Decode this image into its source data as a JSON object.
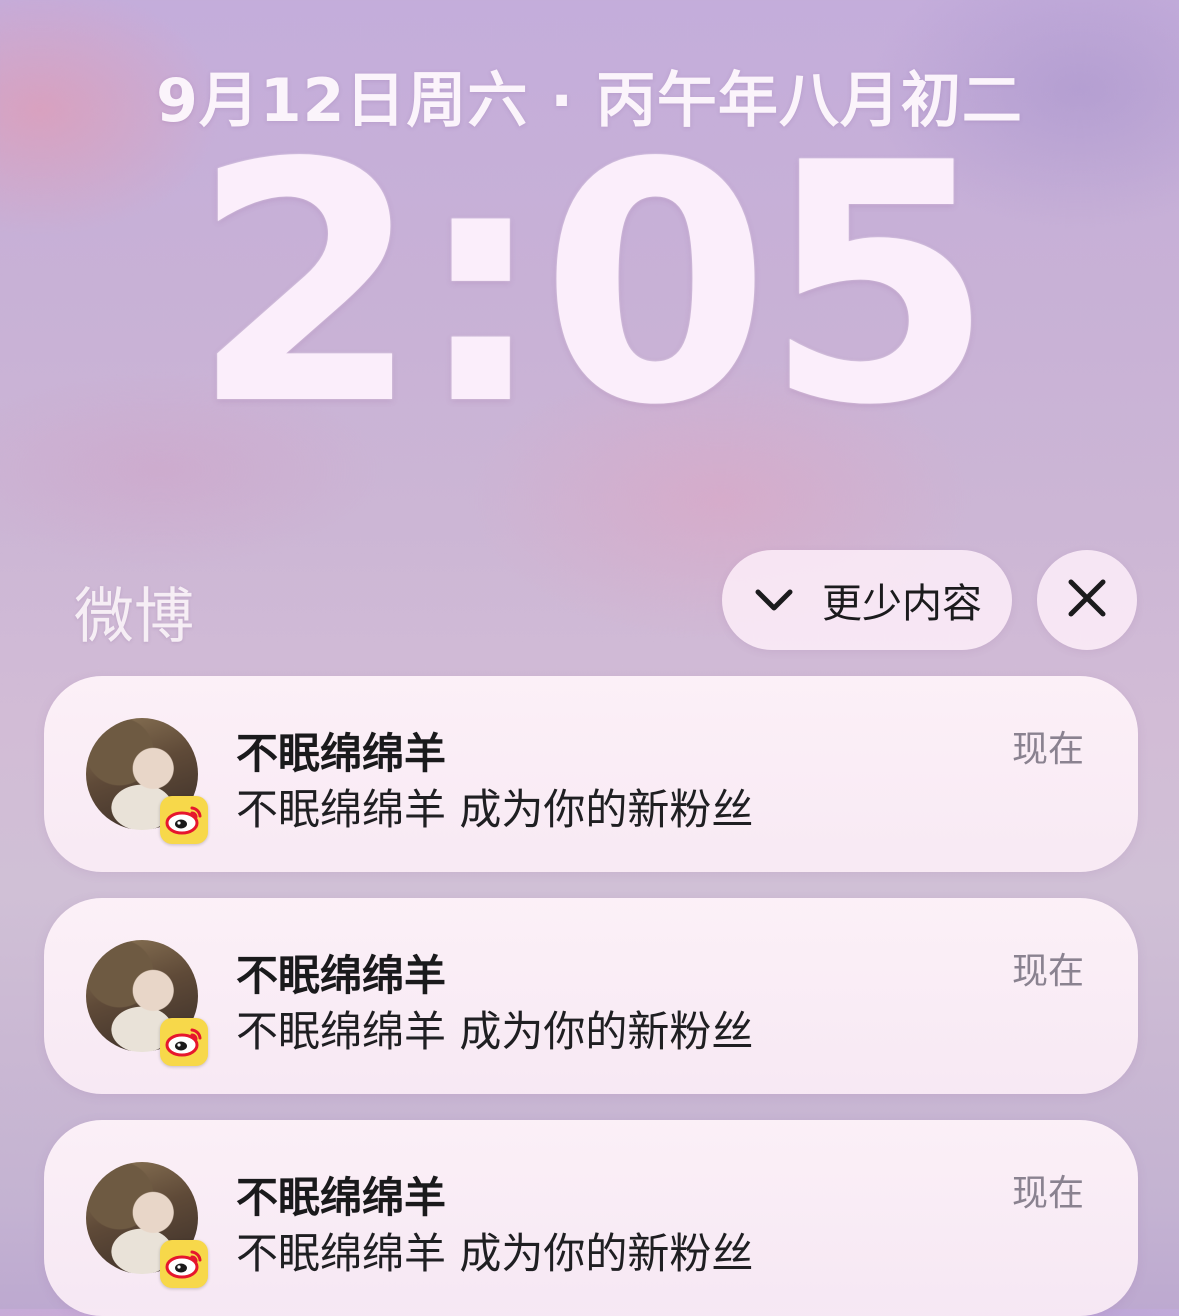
{
  "lockscreen": {
    "date": "9月12日周六 · 丙午年八月初二",
    "time": "2:05"
  },
  "notification_group": {
    "app_name": "微博",
    "show_less_label": "更少内容",
    "close_icon": "close-icon",
    "chevron_icon": "chevron-down-icon",
    "notifications": [
      {
        "sender": "不眠绵绵羊",
        "message": "不眠绵绵羊 成为你的新粉丝",
        "time": "现在",
        "app_badge_icon": "weibo-icon"
      },
      {
        "sender": "不眠绵绵羊",
        "message": "不眠绵绵羊 成为你的新粉丝",
        "time": "现在",
        "app_badge_icon": "weibo-icon"
      },
      {
        "sender": "不眠绵绵羊",
        "message": "不眠绵绵羊 成为你的新粉丝",
        "time": "现在",
        "app_badge_icon": "weibo-icon"
      }
    ]
  },
  "colors": {
    "weibo_badge": "#f7d84a",
    "weibo_eye": "#e6162d"
  }
}
